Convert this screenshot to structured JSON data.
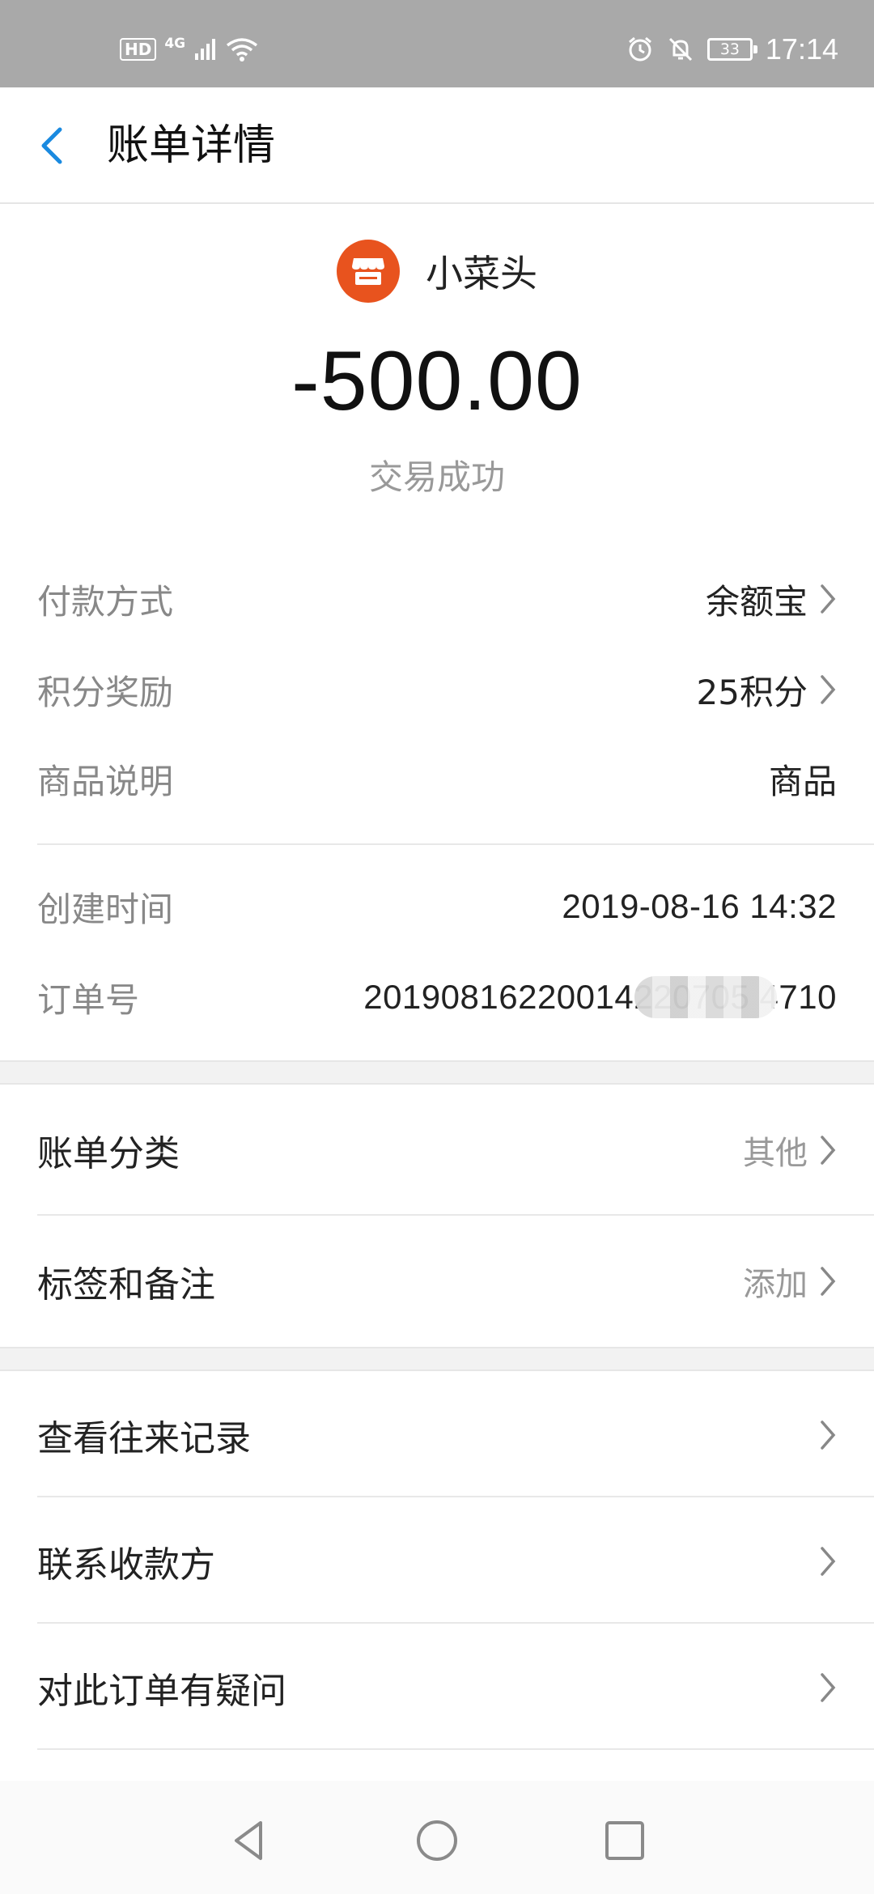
{
  "status_bar": {
    "left_badges": [
      "HD",
      "4G"
    ],
    "battery": "33",
    "time": "17:14"
  },
  "nav": {
    "title": "账单详情"
  },
  "merchant": {
    "name": "小菜头",
    "amount": "-500.00",
    "status": "交易成功"
  },
  "details": [
    {
      "label": "付款方式",
      "value": "余额宝",
      "has_arrow": true
    },
    {
      "label": "积分奖励",
      "value": "25积分",
      "has_arrow": true
    },
    {
      "label": "商品说明",
      "value": "商品",
      "has_arrow": false
    }
  ],
  "meta": [
    {
      "label": "创建时间",
      "value": "2019-08-16 14:32"
    },
    {
      "label": "订单号",
      "value": "20190816220014220705 4710"
    }
  ],
  "category": [
    {
      "label": "账单分类",
      "value": "其他"
    },
    {
      "label": "标签和备注",
      "value": "添加"
    }
  ],
  "actions": [
    {
      "label": "查看往来记录"
    },
    {
      "label": "联系收款方"
    },
    {
      "label": "对此订单有疑问"
    }
  ],
  "colors": {
    "status_bar": "#a9a9a9",
    "accent": "#1a8ae0",
    "merchant_logo": "#e8531e"
  }
}
